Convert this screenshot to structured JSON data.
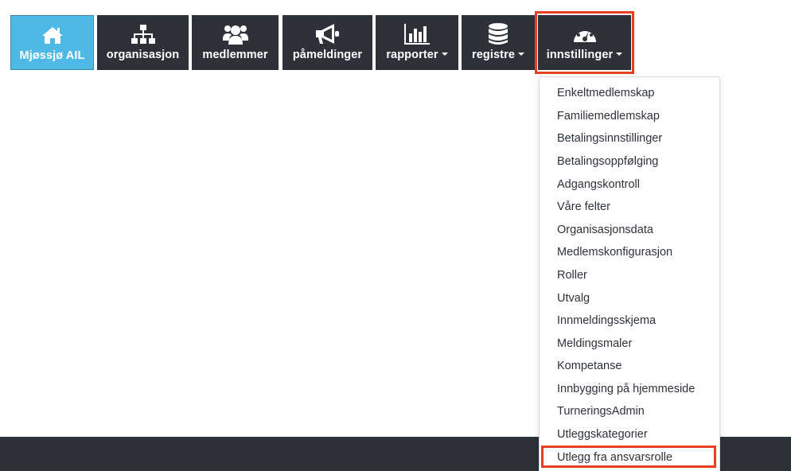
{
  "nav": {
    "items": [
      {
        "label": "Mjøssjø AIL",
        "icon": "home-icon"
      },
      {
        "label": "organisasjon",
        "icon": "sitemap-icon"
      },
      {
        "label": "medlemmer",
        "icon": "users-icon"
      },
      {
        "label": "påmeldinger",
        "icon": "megaphone-icon"
      },
      {
        "label": "rapporter",
        "icon": "bar-chart-icon",
        "dropdown": true
      },
      {
        "label": "registre",
        "icon": "database-icon",
        "dropdown": true
      },
      {
        "label": "innstillinger",
        "icon": "dashboard-gauge-icon",
        "dropdown": true
      }
    ]
  },
  "dropdown": {
    "items": [
      "Enkeltmedlemskap",
      "Familiemedlemskap",
      "Betalingsinnstillinger",
      "Betalingsoppfølging",
      "Adgangskontroll",
      "Våre felter",
      "Organisasjonsdata",
      "Medlemskonfigurasjon",
      "Roller",
      "Utvalg",
      "Innmeldingsskjema",
      "Meldingsmaler",
      "Kompetanse",
      "Innbygging på hjemmeside",
      "TurneringsAdmin",
      "Utleggskategorier",
      "Utlegg fra ansvarsrolle"
    ]
  },
  "colors": {
    "nav_bg": "#2d323a",
    "home_bg": "#4db9e4",
    "highlight": "#e8401c",
    "footer_bg": "#2d323a"
  }
}
